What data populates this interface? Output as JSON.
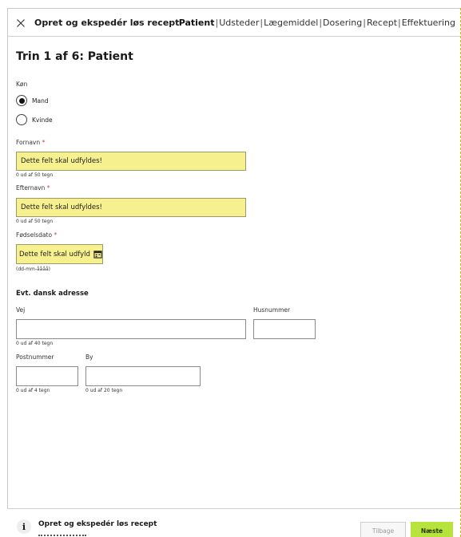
{
  "header": {
    "title": "Opret og ekspedér løs recept",
    "steps": [
      {
        "label": "Patient",
        "active": true
      },
      {
        "label": "Udsteder",
        "active": false
      },
      {
        "label": "Lægemiddel",
        "active": false
      },
      {
        "label": "Dosering",
        "active": false
      },
      {
        "label": "Recept",
        "active": false
      },
      {
        "label": "Effektuering",
        "active": false
      }
    ],
    "separator": "|"
  },
  "step_heading": "Trin 1 af 6: Patient",
  "gender": {
    "label": "Køn",
    "options": [
      {
        "label": "Mand",
        "selected": true
      },
      {
        "label": "Kvinde",
        "selected": false
      }
    ]
  },
  "fornavn": {
    "label": "Fornavn",
    "required_mark": "*",
    "value": "Dette felt skal udfyldes!",
    "counter": "0 ud af 50 tegn"
  },
  "efternavn": {
    "label": "Efternavn",
    "required_mark": "*",
    "value": "Dette felt skal udfyldes!",
    "counter": "0 ud af 50 tegn"
  },
  "foedselsdato": {
    "label": "Fødselsdato",
    "required_mark": "*",
    "value": "Dette felt skal udfyld",
    "hint": "(dd-mm-åååå)"
  },
  "address": {
    "section_title": "Evt. dansk adresse",
    "vej": {
      "label": "Vej",
      "value": "",
      "counter": "0 ud af 40 tegn"
    },
    "husnummer": {
      "label": "Husnummer",
      "value": ""
    },
    "postnummer": {
      "label": "Postnummer",
      "value": "",
      "counter": "0 ud af 4 tegn"
    },
    "by": {
      "label": "By",
      "value": "",
      "counter": "0 ud af 20 tegn"
    }
  },
  "footer": {
    "title": "Opret og ekspedér løs recept",
    "back_label": "Tilbage",
    "next_label": "Næste"
  },
  "colors": {
    "error_field": "#f6f08f",
    "next_button": "#b7e43c",
    "required": "#d0443c"
  }
}
